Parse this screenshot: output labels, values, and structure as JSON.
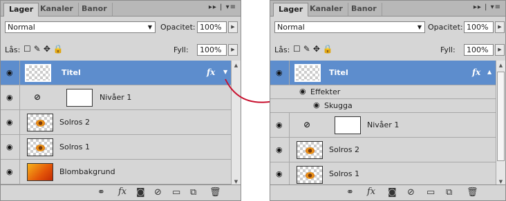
{
  "tabs": [
    "Lager",
    "Kanaler",
    "Banor"
  ],
  "tab_menu": "▸▸ | ▾≡",
  "blend_mode": "Normal",
  "opacity_label": "Opacitet:",
  "opacity_value": "100%",
  "lock_label": "Lås:",
  "fill_label": "Fyll:",
  "fill_value": "100%",
  "left_layers": [
    {
      "name": "Titel",
      "fx": "fx"
    },
    {
      "name": "Nivåer 1"
    },
    {
      "name": "Solros 2"
    },
    {
      "name": "Solros 1"
    },
    {
      "name": "Blombakgrund"
    }
  ],
  "right_layers": [
    {
      "name": "Titel",
      "fx": "fx"
    },
    {
      "name": "Effekter"
    },
    {
      "name": "Skugga"
    },
    {
      "name": "Nivåer 1"
    },
    {
      "name": "Solros 2"
    },
    {
      "name": "Solros 1"
    }
  ],
  "arrow_color": "#c8102e",
  "selection_color": "#5d8dcd"
}
